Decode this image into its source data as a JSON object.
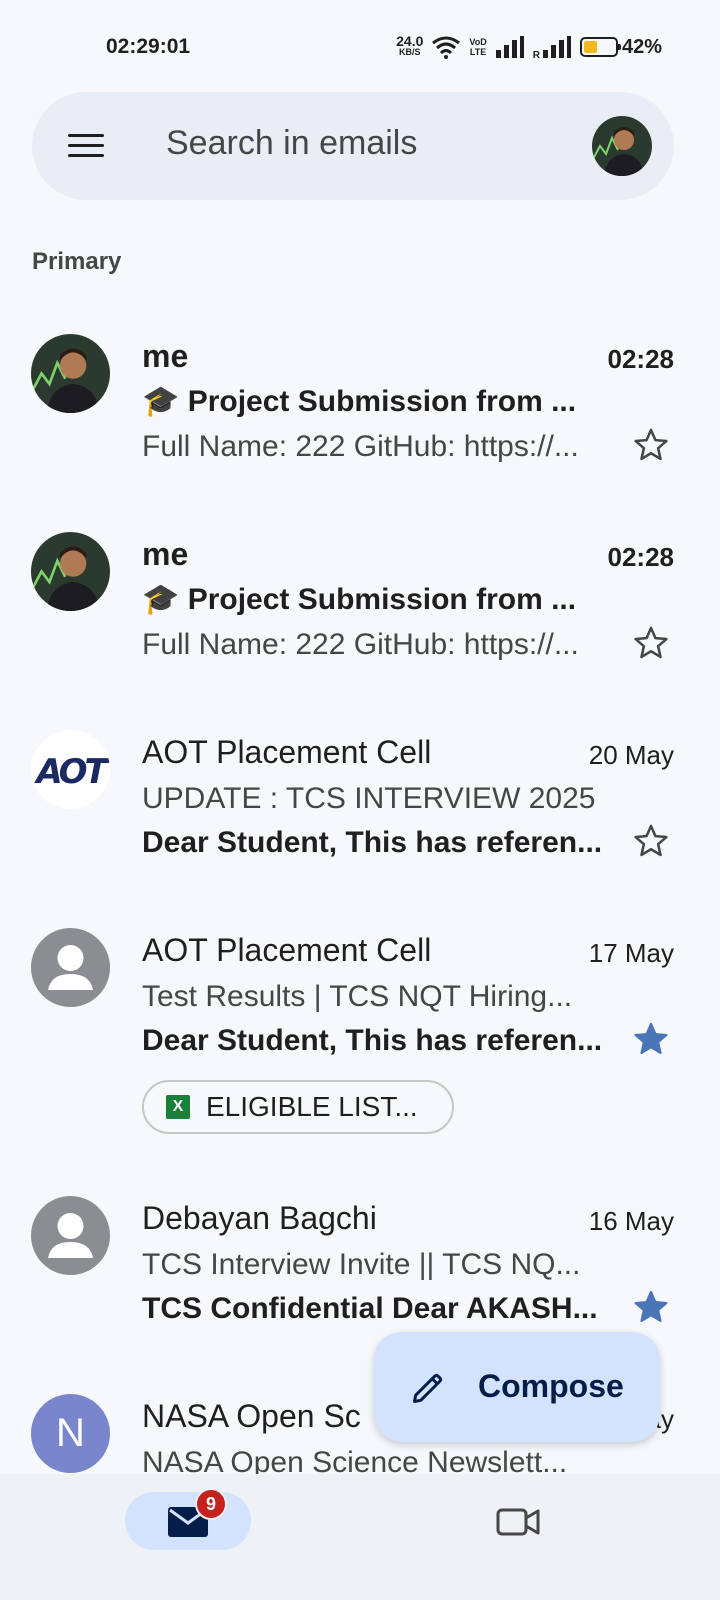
{
  "status_bar": {
    "time": "02:29:01",
    "net_speed_value": "24.0",
    "net_speed_unit": "KB/S",
    "volte_top": "VoD",
    "volte_bottom": "LTE",
    "roaming_label": "R",
    "battery_percent": "42%",
    "battery_level": 0.42,
    "battery_color": "#f2b81d"
  },
  "search": {
    "placeholder": "Search in emails",
    "menu_icon": "hamburger-menu-icon",
    "account_avatar": "profile-photo"
  },
  "section": {
    "label": "Primary"
  },
  "emails": [
    {
      "sender": "me",
      "time": "02:28",
      "subject": "🎓 Project Submission from ...",
      "snippet": "Full Name: 222 GitHub: https://...",
      "starred": false,
      "unread": true,
      "avatar": "profile-photo"
    },
    {
      "sender": "me",
      "time": "02:28",
      "subject": "🎓 Project Submission from ...",
      "snippet": "Full Name: 222 GitHub: https://...",
      "starred": false,
      "unread": true,
      "avatar": "profile-photo"
    },
    {
      "sender": "AOT Placement Cell",
      "time": "20 May",
      "subject": "UPDATE : TCS INTERVIEW 2025",
      "snippet": "Dear Student, This has referen...",
      "starred": false,
      "unread": false,
      "avatar": "aot-logo",
      "avatar_text": "AOT"
    },
    {
      "sender": "AOT Placement Cell",
      "time": "17 May",
      "subject": "Test Results | TCS NQT Hiring...",
      "snippet": "Dear Student, This has referen...",
      "starred": true,
      "unread": false,
      "avatar": "default-person",
      "attachment": "ELIGIBLE LIST..."
    },
    {
      "sender": "Debayan Bagchi",
      "time": "16 May",
      "subject": "TCS Interview Invite || TCS NQ...",
      "snippet": "TCS Confidential Dear AKASH...",
      "starred": true,
      "unread": false,
      "avatar": "default-person"
    },
    {
      "sender": "NASA Open Sc",
      "time": "ay",
      "subject": "NASA Open Science Newslett...",
      "avatar": "letter",
      "avatar_letter": "N",
      "avatar_color": "#7986cb"
    }
  ],
  "compose": {
    "label": "Compose"
  },
  "bottom_nav": {
    "mail_badge": "9",
    "mail_icon": "mail-icon",
    "meet_icon": "video-camera-icon"
  },
  "colors": {
    "background": "#f6f8fc",
    "search_bg": "#e9eef6",
    "compose_bg": "#d3e3fd",
    "star_filled": "#4a76b8",
    "badge": "#c5221f",
    "aot_blue": "#1b2a63"
  }
}
